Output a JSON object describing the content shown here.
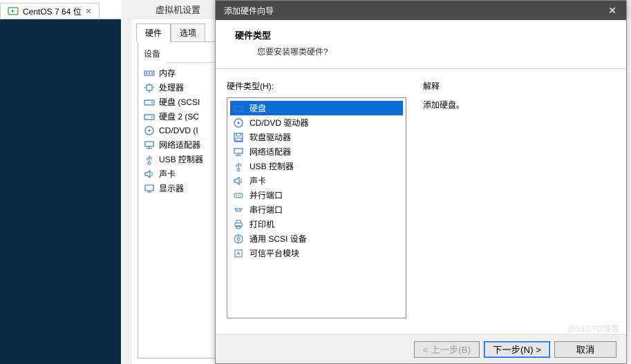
{
  "vmTab": {
    "label": "CentOS 7 64 位"
  },
  "settings": {
    "title": "虚拟机设置",
    "tabs": {
      "hardware": "硬件",
      "options": "选项"
    },
    "device_header": "设备",
    "devices": [
      {
        "icon": "memory",
        "label": "内存"
      },
      {
        "icon": "cpu",
        "label": "处理器"
      },
      {
        "icon": "disk",
        "label": "硬盘 (SCSI"
      },
      {
        "icon": "disk",
        "label": "硬盘 2 (SC"
      },
      {
        "icon": "cd",
        "label": "CD/DVD (I"
      },
      {
        "icon": "net",
        "label": "网络适配器"
      },
      {
        "icon": "usb",
        "label": "USB 控制器"
      },
      {
        "icon": "sound",
        "label": "声卡"
      },
      {
        "icon": "display",
        "label": "显示器"
      }
    ]
  },
  "wizard": {
    "title": "添加硬件向导",
    "heading": "硬件类型",
    "subheading": "您要安装哪类硬件?",
    "listLabel": "硬件类型(H):",
    "descLabel": "解释",
    "descText": "添加硬盘。",
    "options": [
      {
        "icon": "disk",
        "label": "硬盘",
        "selected": true
      },
      {
        "icon": "cd",
        "label": "CD/DVD 驱动器"
      },
      {
        "icon": "floppy",
        "label": "软盘驱动器"
      },
      {
        "icon": "net",
        "label": "网络适配器"
      },
      {
        "icon": "usb",
        "label": "USB 控制器"
      },
      {
        "icon": "sound",
        "label": "声卡"
      },
      {
        "icon": "parallel",
        "label": "并行端口"
      },
      {
        "icon": "serial",
        "label": "串行端口"
      },
      {
        "icon": "printer",
        "label": "打印机"
      },
      {
        "icon": "scsi",
        "label": "通用 SCSI 设备"
      },
      {
        "icon": "tpm",
        "label": "可信平台模块"
      }
    ],
    "buttons": {
      "back": "< 上一步(B)",
      "next": "下一步(N) >",
      "cancel": "取消"
    }
  },
  "watermark": "@51CTO博客"
}
